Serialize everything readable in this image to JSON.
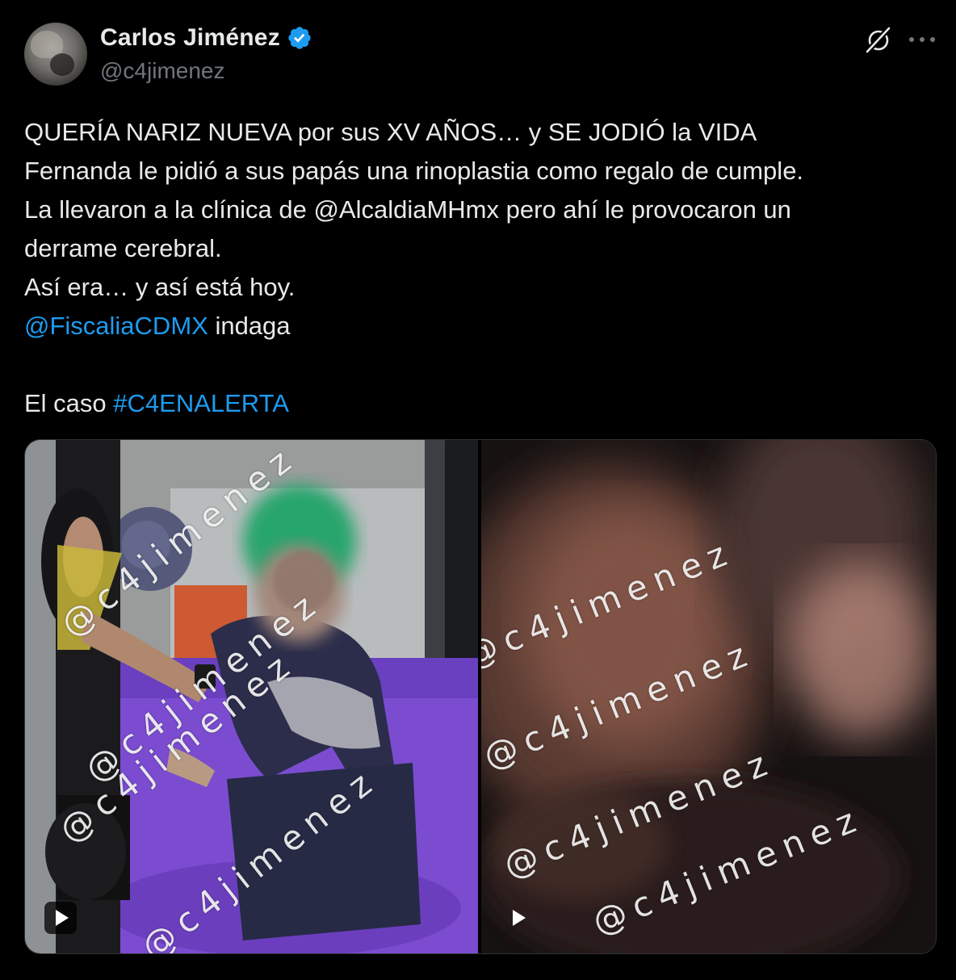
{
  "author": {
    "display_name": "Carlos Jiménez",
    "handle": "@c4jimenez",
    "verified_color": "#1d9bf0"
  },
  "actions": {
    "grok_icon": "grok-icon",
    "more_icon": "more-options-icon"
  },
  "tweet": {
    "line1": "QUERÍA NARIZ NUEVA por sus XV AÑOS… y SE JODIÓ la VIDA",
    "line2": "Fernanda le pidió a sus papás una rinoplastia como regalo de cumple.",
    "line3": "La llevaron a la clínica de @AlcaldiaMHmx pero ahí le provocaron un",
    "line4": "derrame cerebral.",
    "line5": "Así era… y así está hoy.",
    "mention": "@FiscaliaCDMX",
    "line6_rest": " indaga",
    "line7_prefix": "El caso ",
    "hashtag": "#C4ENALERTA",
    "link_color": "#1d9bf0"
  },
  "media": {
    "watermark": "@c4jimenez",
    "left_play_icon": "play-icon",
    "right_play_icon": "play-icon"
  }
}
